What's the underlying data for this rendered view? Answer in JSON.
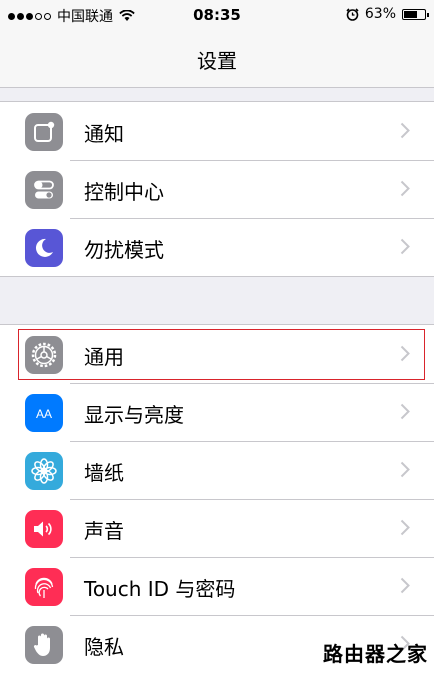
{
  "status_bar": {
    "carrier": "中国联通",
    "time": "08:35",
    "battery": "63%",
    "battery_level": 0.63,
    "signal_bars_filled": 3,
    "signal_bars_total": 5
  },
  "nav": {
    "title": "设置"
  },
  "group1": [
    {
      "label": "通知",
      "icon": "notifications-icon",
      "color": "#8e8e93"
    },
    {
      "label": "控制中心",
      "icon": "control-center-icon",
      "color": "#8e8e93"
    },
    {
      "label": "勿扰模式",
      "icon": "do-not-disturb-icon",
      "color": "#5856d6"
    }
  ],
  "group2": [
    {
      "label": "通用",
      "icon": "gear-icon",
      "color": "#8e8e93",
      "selected": true
    },
    {
      "label": "显示与亮度",
      "icon": "display-brightness-icon",
      "color": "#007aff",
      "glyph": "AA"
    },
    {
      "label": "墙纸",
      "icon": "wallpaper-icon",
      "color": "#34aadc"
    },
    {
      "label": "声音",
      "icon": "sound-icon",
      "color": "#ff2d55"
    },
    {
      "label": "Touch ID 与密码",
      "icon": "touch-id-icon",
      "color": "#ff2d55"
    },
    {
      "label": "隐私",
      "icon": "privacy-hand-icon",
      "color": "#8e8e93"
    }
  ],
  "watermark": "路由器之家"
}
